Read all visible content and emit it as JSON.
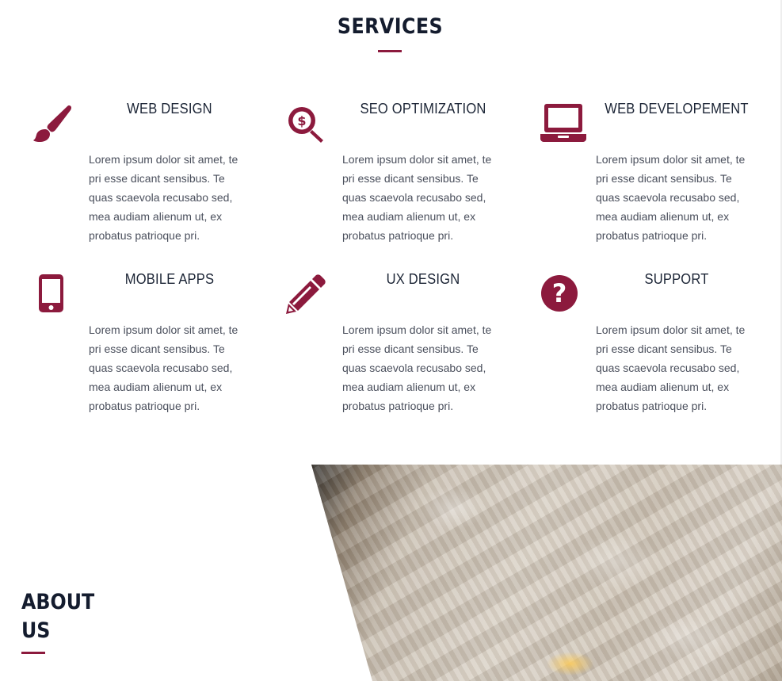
{
  "services": {
    "title": "SERVICES",
    "accent_color": "#8c1a3d",
    "items": [
      {
        "name": "WEB DESIGN",
        "icon": "paintbrush-icon",
        "lines": [
          "Lorem ipsum dolor sit amet, te",
          "pri esse dicant sensibus. Te",
          "quas scaevola recusabo sed,",
          "mea audiam alienum ut, ex",
          "probatus patrioque pri."
        ]
      },
      {
        "name": "SEO OPTIMIZATION",
        "icon": "search-dollar-icon",
        "lines": [
          "Lorem ipsum dolor sit amet, te",
          "pri esse dicant sensibus. Te",
          "quas scaevola recusabo sed,",
          "mea audiam alienum ut, ex",
          "probatus patrioque pri."
        ]
      },
      {
        "name": "WEB DEVELOPEMENT",
        "icon": "laptop-icon",
        "lines": [
          "Lorem ipsum dolor sit amet, te",
          "pri esse dicant sensibus. Te",
          "quas scaevola recusabo sed,",
          "mea audiam alienum ut, ex",
          "probatus patrioque pri."
        ]
      },
      {
        "name": "MOBILE APPS",
        "icon": "mobile-phone-icon",
        "lines": [
          "Lorem ipsum dolor sit amet, te",
          "pri esse dicant sensibus. Te",
          "quas scaevola recusabo sed,",
          "mea audiam alienum ut, ex",
          "probatus patrioque pri."
        ]
      },
      {
        "name": "UX DESIGN",
        "icon": "pencil-icon",
        "lines": [
          "Lorem ipsum dolor sit amet, te",
          "pri esse dicant sensibus. Te",
          "quas scaevola recusabo sed,",
          "mea audiam alienum ut, ex",
          "probatus patrioque pri."
        ]
      },
      {
        "name": "SUPPORT",
        "icon": "question-circle-icon",
        "lines": [
          "Lorem ipsum dolor sit amet, te",
          "pri esse dicant sensibus. Te",
          "quas scaevola recusabo sed,",
          "mea audiam alienum ut, ex",
          "probatus patrioque pri."
        ]
      }
    ]
  },
  "about": {
    "title_line1": "ABOUT",
    "title_line2": "US"
  }
}
